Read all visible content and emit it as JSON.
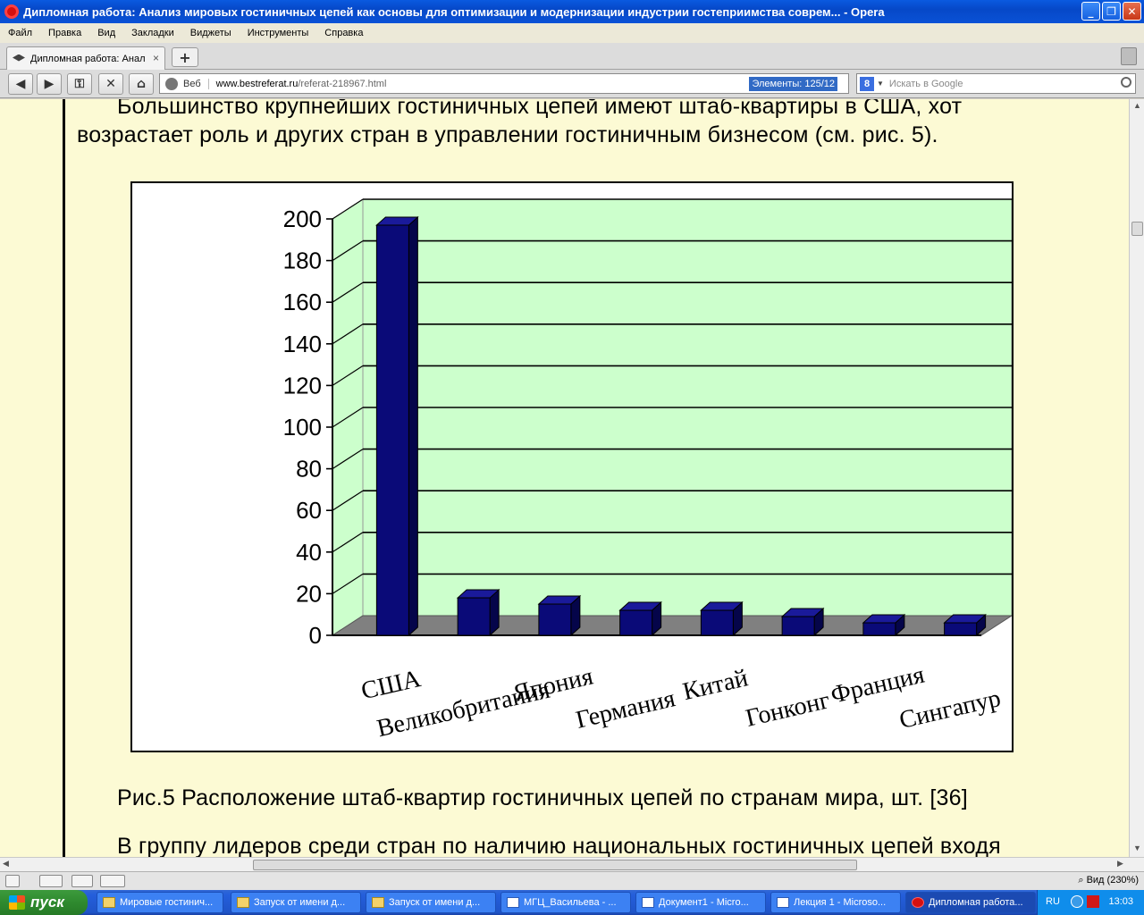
{
  "window": {
    "title": "Дипломная работа: Анализ мировых гостиничных цепей как основы для оптимизации и модернизации индустрии гостеприимства соврем... - Opera",
    "minimize": "_",
    "maximize": "❐",
    "close": "✕"
  },
  "menu": [
    "Файл",
    "Правка",
    "Вид",
    "Закладки",
    "Виджеты",
    "Инструменты",
    "Справка"
  ],
  "tab": {
    "label": "Дипломная работа: Анал",
    "close": "×",
    "new": "+"
  },
  "nav": {
    "back": "◀",
    "forward": "▶",
    "key": "⚿",
    "stop": "✕",
    "home": "⌂",
    "web_label": "Веб",
    "url_host": "www.bestreferat.ru",
    "url_path": "/referat-218967.html",
    "find": "Элементы:   125/12",
    "search_placeholder": "Искать в Google",
    "search_engine": "8"
  },
  "page": {
    "para1_line1": "Большинство  крупнейших  гостиничных  цепей  имеют  штаб-квартиры  в  США,  хот",
    "para1_line2": "возрастает роль и других стран в управлении гостиничным бизнесом (см. рис. 5).",
    "caption": "Рис.5 Расположение штаб-квартир гостиничных цепей по странам мира, шт. [36]",
    "para2_line1": "В  группу  лидеров  среди  стран  по  наличию  национальных  гостиничных  цепей  входя"
  },
  "chart_data": {
    "type": "bar",
    "categories": [
      "США",
      "Великобритания",
      "Япония",
      "Германия",
      "Китай",
      "Гонконг",
      "Франция",
      "Сингапур"
    ],
    "values": [
      197,
      18,
      15,
      12,
      12,
      9,
      6,
      6
    ],
    "ylim": [
      0,
      200
    ],
    "yticks": [
      0,
      20,
      40,
      60,
      80,
      100,
      120,
      140,
      160,
      180,
      200
    ],
    "grid": true,
    "style": "3d",
    "colors": {
      "bar": "#0a0a78",
      "wall": "#ccffcc",
      "floor": "#808080"
    }
  },
  "status": {
    "zoom": "Вид (230%)"
  },
  "taskbar": {
    "start": "пуск",
    "tasks": [
      {
        "label": "Мировые гостинич...",
        "icon": "folder"
      },
      {
        "label": "Запуск от имени д...",
        "icon": "folder"
      },
      {
        "label": "Запуск от имени д...",
        "icon": "folder"
      },
      {
        "label": "МГЦ_Васильева - ...",
        "icon": "word"
      },
      {
        "label": "Документ1 - Micro...",
        "icon": "word"
      },
      {
        "label": "Лекция 1 - Microso...",
        "icon": "word"
      },
      {
        "label": "Дипломная работа...",
        "icon": "opera"
      }
    ],
    "lang": "RU",
    "time": "13:03"
  }
}
